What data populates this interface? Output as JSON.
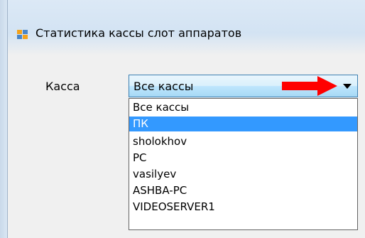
{
  "window": {
    "title": "Статистика кассы слот аппаратов",
    "icon": "app-window-icon"
  },
  "form": {
    "kassa_label": "Касса",
    "combo_value": "Все кассы",
    "options": [
      "Все кассы",
      "ПК",
      "sholokhov",
      "PC",
      "vasilyev",
      "ASHBA-PC",
      "VIDEOSERVER1"
    ],
    "selected_option": "ПК"
  },
  "annotation": {
    "arrow_color": "#ff0000"
  },
  "colors": {
    "selection": "#3399ff",
    "combo_border": "#3c7fb1"
  }
}
